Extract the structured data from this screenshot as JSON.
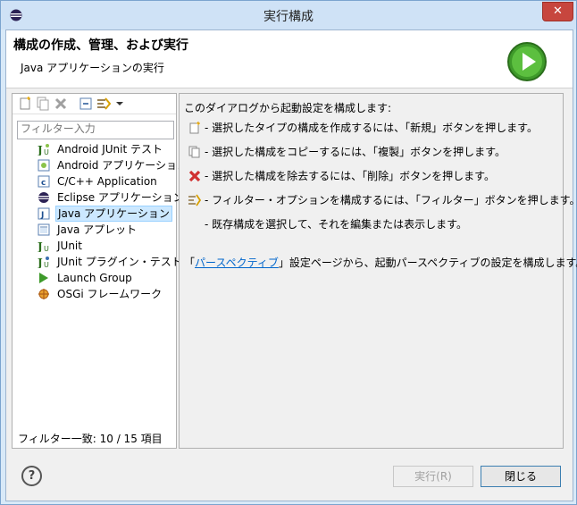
{
  "window": {
    "title": "実行構成",
    "close_glyph": "✕"
  },
  "header": {
    "title": "構成の作成、管理、および実行",
    "subtitle": "Java アプリケーションの実行"
  },
  "left": {
    "toolbar_icons": [
      "new-config-icon",
      "duplicate-icon",
      "delete-icon",
      "collapse-all-icon",
      "filter-icon",
      "dropdown-icon"
    ],
    "filter_placeholder": "フィルター入力",
    "items": [
      {
        "label": "Android JUnit テスト",
        "icon": "android-junit-icon"
      },
      {
        "label": "Android アプリケーション",
        "icon": "android-app-icon"
      },
      {
        "label": "C/C++ Application",
        "icon": "cpp-app-icon"
      },
      {
        "label": "Eclipse アプリケーション",
        "icon": "eclipse-app-icon"
      },
      {
        "label": "Java アプリケーション",
        "icon": "java-app-icon"
      },
      {
        "label": "Java アプレット",
        "icon": "java-applet-icon"
      },
      {
        "label": "JUnit",
        "icon": "junit-icon"
      },
      {
        "label": "JUnit プラグイン・テスト",
        "icon": "junit-plugin-icon"
      },
      {
        "label": "Launch Group",
        "icon": "launch-group-icon"
      },
      {
        "label": "OSGi フレームワーク",
        "icon": "osgi-icon"
      }
    ],
    "filter_count": "フィルター一致: 10 / 15 項目"
  },
  "right": {
    "intro": "このダイアログから起動設定を構成します:",
    "rows": [
      {
        "text": "- 選択したタイプの構成を作成するには、「新規」ボタンを押します。",
        "icon": "new-config-icon"
      },
      {
        "text": "- 選択した構成をコピーするには、「複製」ボタンを押します。",
        "icon": "duplicate-icon"
      },
      {
        "text": "- 選択した構成を除去するには、「削除」ボタンを押します。",
        "icon": "delete-icon"
      },
      {
        "text": "- フィルター・オプションを構成するには、「フィルター」ボタンを押します。",
        "icon": "filter-icon"
      },
      {
        "text": "- 既存構成を選択して、それを編集または表示します。",
        "icon": ""
      }
    ],
    "persp_prefix": "「",
    "persp_link": "パースペクティブ",
    "persp_suffix": "」設定ページから、起動パースペクティブの設定を構成します。"
  },
  "footer": {
    "help_glyph": "?",
    "run_label": "実行(R)",
    "close_label": "閉じる"
  }
}
